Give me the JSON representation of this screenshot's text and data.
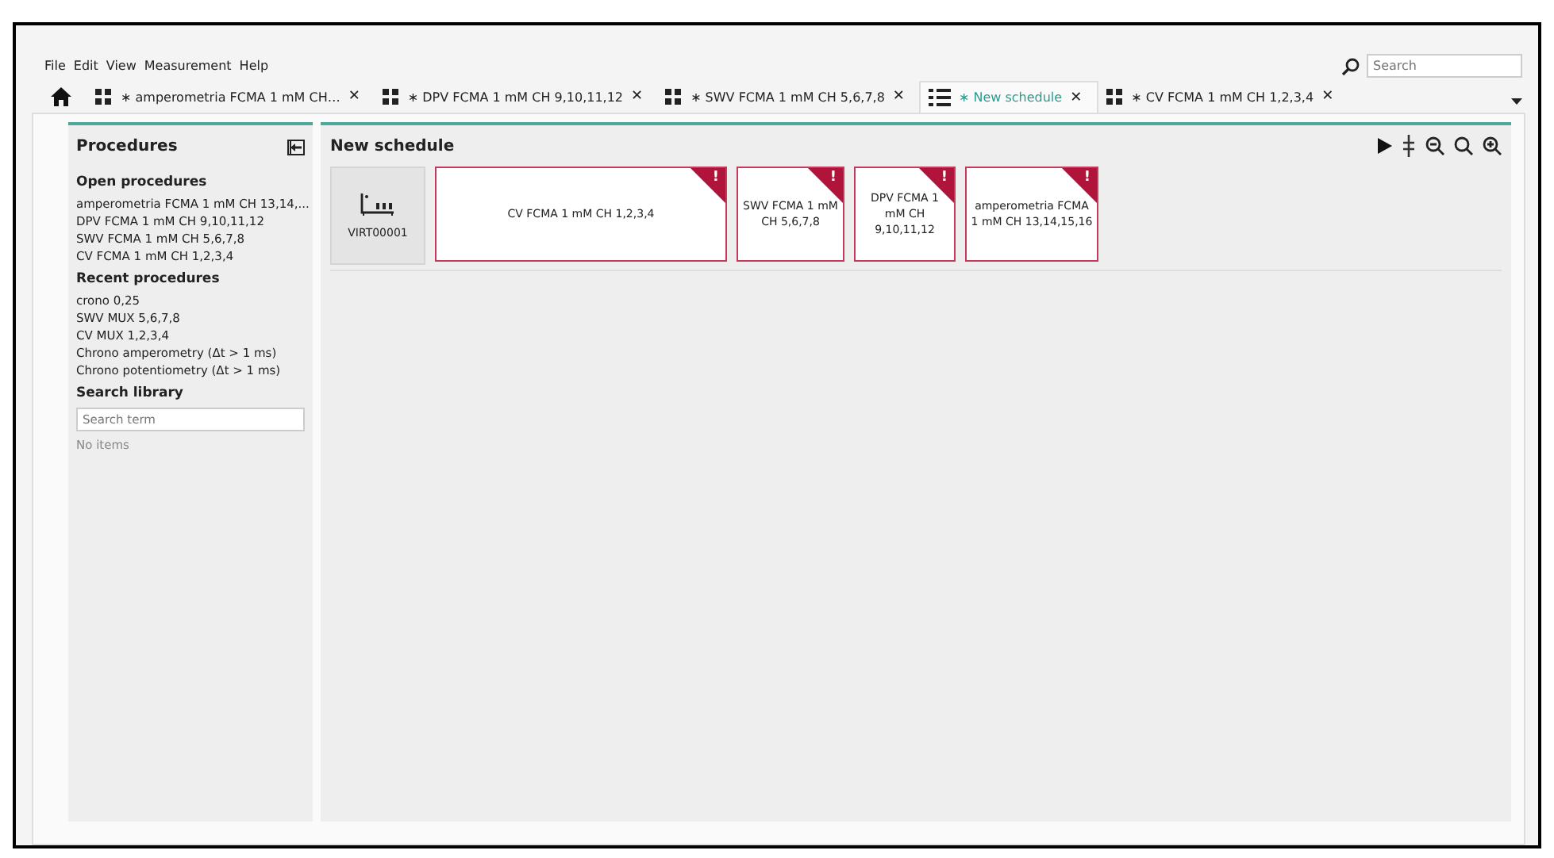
{
  "menu": [
    "File",
    "Edit",
    "View",
    "Measurement",
    "Help"
  ],
  "search": {
    "placeholder": "Search"
  },
  "tabs": [
    {
      "kind": "grid",
      "label": "∗ amperometria FCMA 1 mM CH…",
      "close": "✕",
      "selected": false
    },
    {
      "kind": "grid",
      "label": "∗ DPV FCMA 1 mM CH 9,10,11,12",
      "close": "✕",
      "selected": false
    },
    {
      "kind": "grid",
      "label": "∗ SWV FCMA 1 mM CH 5,6,7,8",
      "close": "✕",
      "selected": false
    },
    {
      "kind": "list",
      "label": "∗ New schedule",
      "close": "✕",
      "selected": true
    },
    {
      "kind": "grid",
      "label": "∗ CV FCMA 1 mM CH 1,2,3,4",
      "close": "✕",
      "selected": false
    }
  ],
  "sidebar": {
    "title": "Procedures",
    "sections": [
      {
        "heading": "Open procedures",
        "items": [
          "amperometria FCMA 1 mM CH 13,14,...",
          "DPV FCMA 1 mM CH 9,10,11,12",
          "SWV FCMA 1 mM CH 5,6,7,8",
          "CV FCMA 1 mM CH 1,2,3,4"
        ]
      },
      {
        "heading": "Recent procedures",
        "items": [
          "crono 0,25",
          "SWV MUX 5,6,7,8",
          "CV MUX 1,2,3,4",
          "Chrono amperometry (Δt > 1 ms)",
          "Chrono potentiometry (Δt > 1 ms)"
        ]
      }
    ],
    "library": {
      "heading": "Search library",
      "placeholder": "Search term",
      "empty": "No items"
    }
  },
  "schedule": {
    "title": "New schedule",
    "device": "VIRT00001",
    "steps": [
      {
        "label": "CV FCMA 1 mM CH 1,2,3,4",
        "flag": "!"
      },
      {
        "label": "SWV FCMA 1 mM CH 5,6,7,8",
        "flag": "!"
      },
      {
        "label": "DPV FCMA 1 mM CH 9,10,11,12",
        "flag": "!"
      },
      {
        "label": "amperometria FCMA 1 mM CH 13,14,15,16",
        "flag": "!"
      }
    ]
  }
}
